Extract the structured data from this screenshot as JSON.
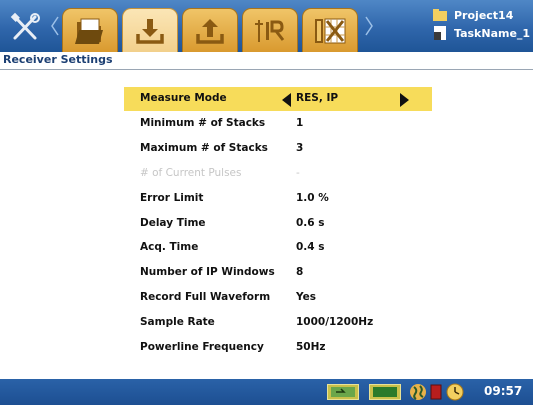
{
  "app": {
    "project_name": "Project14",
    "task_name": "TaskName_1"
  },
  "toolbar": {
    "tabs": [
      {
        "name": "tools",
        "icon": "tools-icon"
      },
      {
        "name": "project",
        "icon": "project-folder-icon"
      },
      {
        "name": "receive",
        "icon": "download-tray-icon"
      },
      {
        "name": "transmit",
        "icon": "upload-tray-icon"
      },
      {
        "name": "survey",
        "icon": "receiver-ir-icon"
      },
      {
        "name": "layout",
        "icon": "grid-tools-icon"
      }
    ],
    "active_tab": "receive"
  },
  "page": {
    "title": "Receiver Settings"
  },
  "settings": {
    "rows": [
      {
        "label": "Measure Mode",
        "value": "RES, IP",
        "selected": true,
        "disabled": false
      },
      {
        "label": "Minimum # of Stacks",
        "value": "1",
        "selected": false,
        "disabled": false
      },
      {
        "label": "Maximum # of Stacks",
        "value": "3",
        "selected": false,
        "disabled": false
      },
      {
        "label": "# of Current Pulses",
        "value": "-",
        "selected": false,
        "disabled": true
      },
      {
        "label": "Error Limit",
        "value": "1.0 %",
        "selected": false,
        "disabled": false
      },
      {
        "label": "Delay Time",
        "value": "0.6 s",
        "selected": false,
        "disabled": false
      },
      {
        "label": "Acq. Time",
        "value": "0.4 s",
        "selected": false,
        "disabled": false
      },
      {
        "label": "Number of IP Windows",
        "value": "8",
        "selected": false,
        "disabled": false
      },
      {
        "label": "Record Full Waveform",
        "value": "Yes",
        "selected": false,
        "disabled": false
      },
      {
        "label": "Sample Rate",
        "value": "1000/1200Hz",
        "selected": false,
        "disabled": false
      },
      {
        "label": "Powerline Frequency",
        "value": "50Hz",
        "selected": false,
        "disabled": false
      }
    ]
  },
  "status": {
    "time": "09:57",
    "icons": [
      "battery-charging-icon",
      "battery-icon",
      "globe-icon",
      "record-indicator-icon",
      "clock-icon"
    ]
  },
  "colors": {
    "topbar": "#2f66ab",
    "tab": "#d99a2f",
    "highlight": "#f7dc5a",
    "statusbar": "#1d4f92"
  }
}
